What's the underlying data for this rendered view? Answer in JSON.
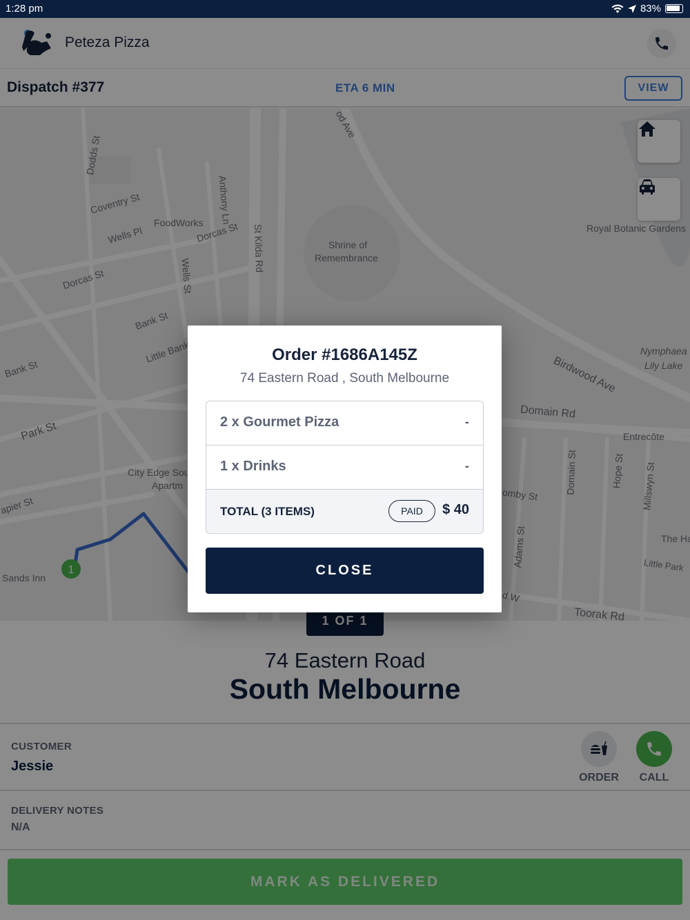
{
  "status_bar": {
    "time": "1:28 pm",
    "battery": "83%"
  },
  "header": {
    "brand": "Peteza Pizza"
  },
  "dispatch": {
    "title": "Dispatch #377",
    "eta": "ETA 6 MIN",
    "view_label": "VIEW"
  },
  "map": {
    "labels": [
      "Dodds St",
      "Coventry St",
      "Wells Pl",
      "FoodWorks",
      "Dorcas St",
      "Dorcas St",
      "Anthony Ln",
      "Wells St",
      "St Kilda Rd",
      "Shrine of",
      "Remembrance",
      "Royal Botanic Gardens",
      "Bank St",
      "Bank St",
      "Little Bank",
      "Park St",
      "City Edge Sou",
      "Apartm",
      "apier St",
      "Sands Inn",
      "Birdwood Ave",
      "Nymphaea",
      "Lily Lake",
      "Domain Rd",
      "Entrecôte",
      "Domain St",
      "Hope St",
      "Millswyn St",
      "omby St",
      "Adams St",
      "The Ha",
      "Little Park",
      "Toorak Rd",
      "od Ave",
      "d W"
    ],
    "marker_label": "1"
  },
  "stop_indicator": "1 OF 1",
  "destination": {
    "street": "74 Eastern Road",
    "suburb": "South Melbourne"
  },
  "customer": {
    "label": "CUSTOMER",
    "name": "Jessie",
    "order_label": "ORDER",
    "call_label": "CALL"
  },
  "notes": {
    "label": "DELIVERY NOTES",
    "value": "N/A"
  },
  "deliver_label": "MARK AS DELIVERED",
  "modal": {
    "title": "Order #1686A145Z",
    "address": "74 Eastern Road , South Melbourne",
    "items": [
      {
        "name": "2 x Gourmet Pizza",
        "value": "-"
      },
      {
        "name": "1 x Drinks",
        "value": "-"
      }
    ],
    "total_label": "TOTAL (3 ITEMS)",
    "paid_label": "PAID",
    "total_amount": "$ 40",
    "close_label": "CLOSE"
  },
  "colors": {
    "navy": "#0b1f3f",
    "accent_blue": "#3e7bd6",
    "green": "#5fcd6a"
  }
}
